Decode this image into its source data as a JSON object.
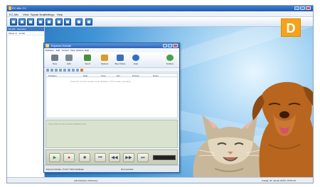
{
  "window": {
    "title": "EC-Mic 2.0",
    "menu": [
      "EC-Mic",
      "View",
      "Speak Now",
      "Settings",
      "Help"
    ]
  },
  "toolbar": {
    "icons": [
      "record-icon",
      "save-icon",
      "open-icon",
      "search-icon",
      "list-icon",
      "edit-icon",
      "settings-icon",
      "document-icon",
      "close-icon"
    ]
  },
  "left_panel": {
    "header": "EC-Mic · Recorder",
    "row": "Player (1 · enroll)"
  },
  "badge": {
    "letter": "D",
    "color": "#f5a31a"
  },
  "desktop": {
    "logo": "V"
  },
  "app_window": {
    "title": "Express Dictate",
    "menu": [
      "Dictation",
      "Edit",
      "Control",
      "View",
      "Options",
      "Help"
    ],
    "ribbon": [
      {
        "label": "New",
        "icon": "new-document-icon",
        "color": "#6f7c8a"
      },
      {
        "label": "Edit",
        "icon": "edit-icon",
        "color": "#7a8797"
      },
      {
        "label": "Send",
        "icon": "send-icon",
        "color": "#4a8f3a"
      },
      {
        "label": "Options",
        "icon": "options-icon",
        "color": "#d89b2b"
      },
      {
        "label": "Buy Online",
        "icon": "cart-icon",
        "color": "#3c6fb5"
      },
      {
        "label": "Help",
        "icon": "help-icon",
        "color": "#2f6fc7"
      },
      {
        "label": "Toolbox",
        "icon": "toolbox-icon",
        "color": "#4aa04a"
      }
    ],
    "columns": [
      "Dictation",
      "Date",
      "Time",
      "Dur",
      "Priority",
      "Notes"
    ],
    "empty_message": "Press F2 or F4 to create a new dictation or F3 to start recording",
    "notes_placeholder": "Type notes for the current dictation here",
    "transport": [
      "play",
      "record",
      "stop",
      "start",
      "rewind",
      "fast-forward",
      "end"
    ],
    "status_left": "Express Dictate v 5.10 © NCH Software",
    "status_mid": "Not recorded"
  },
  "statusbar": {
    "left": "Administrator | Dictionary",
    "right": "Freitag, 30. Januar 2015 | 13:56 Uhr"
  }
}
